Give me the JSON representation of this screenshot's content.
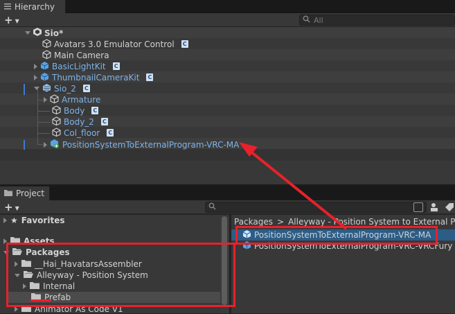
{
  "hierarchy": {
    "tab_label": "Hierarchy",
    "search_placeholder": "All",
    "items": [
      {
        "label": "Sio*",
        "kind": "scene"
      },
      {
        "label": "Avatars 3.0 Emulator Control",
        "kind": "object"
      },
      {
        "label": "Main Camera",
        "kind": "object"
      },
      {
        "label": "BasicLightKit",
        "kind": "prefab"
      },
      {
        "label": "ThumbnailCameraKit",
        "kind": "prefab"
      },
      {
        "label": "Sio_2",
        "kind": "prefab-variant"
      },
      {
        "label": "Armature",
        "kind": "prefab"
      },
      {
        "label": "Body",
        "kind": "prefab"
      },
      {
        "label": "Body_2",
        "kind": "prefab"
      },
      {
        "label": "Col_floor",
        "kind": "prefab"
      },
      {
        "label": "PositionSystemToExternalProgram-VRC-MA",
        "kind": "prefab-added"
      }
    ]
  },
  "project": {
    "tab_label": "Project",
    "breadcrumb": [
      "Packages",
      ">",
      "Alleyway - Position System to External Prog"
    ],
    "tree": [
      {
        "label": "Favorites",
        "bold": true
      },
      {
        "label": "Assets",
        "bold": true
      },
      {
        "label": "Packages",
        "bold": true
      },
      {
        "label": "__Hai_HavatarsAssembler",
        "bold": false
      },
      {
        "label": "Alleyway - Position System",
        "bold": false
      },
      {
        "label": "Internal",
        "bold": false
      },
      {
        "label": "Prefab",
        "bold": false
      },
      {
        "label": "Animator As Code V1",
        "bold": false
      }
    ],
    "assets": [
      {
        "label": "PositionSystemToExternalProgram-VRC-MA",
        "selected": true
      },
      {
        "label": "PositionSystemToExternalProgram-VRC-VRCFury",
        "selected": false
      }
    ]
  },
  "colors": {
    "highlight": "#e8212c",
    "prefab_text": "#7eb3e8",
    "selection": "#2c5d87"
  }
}
